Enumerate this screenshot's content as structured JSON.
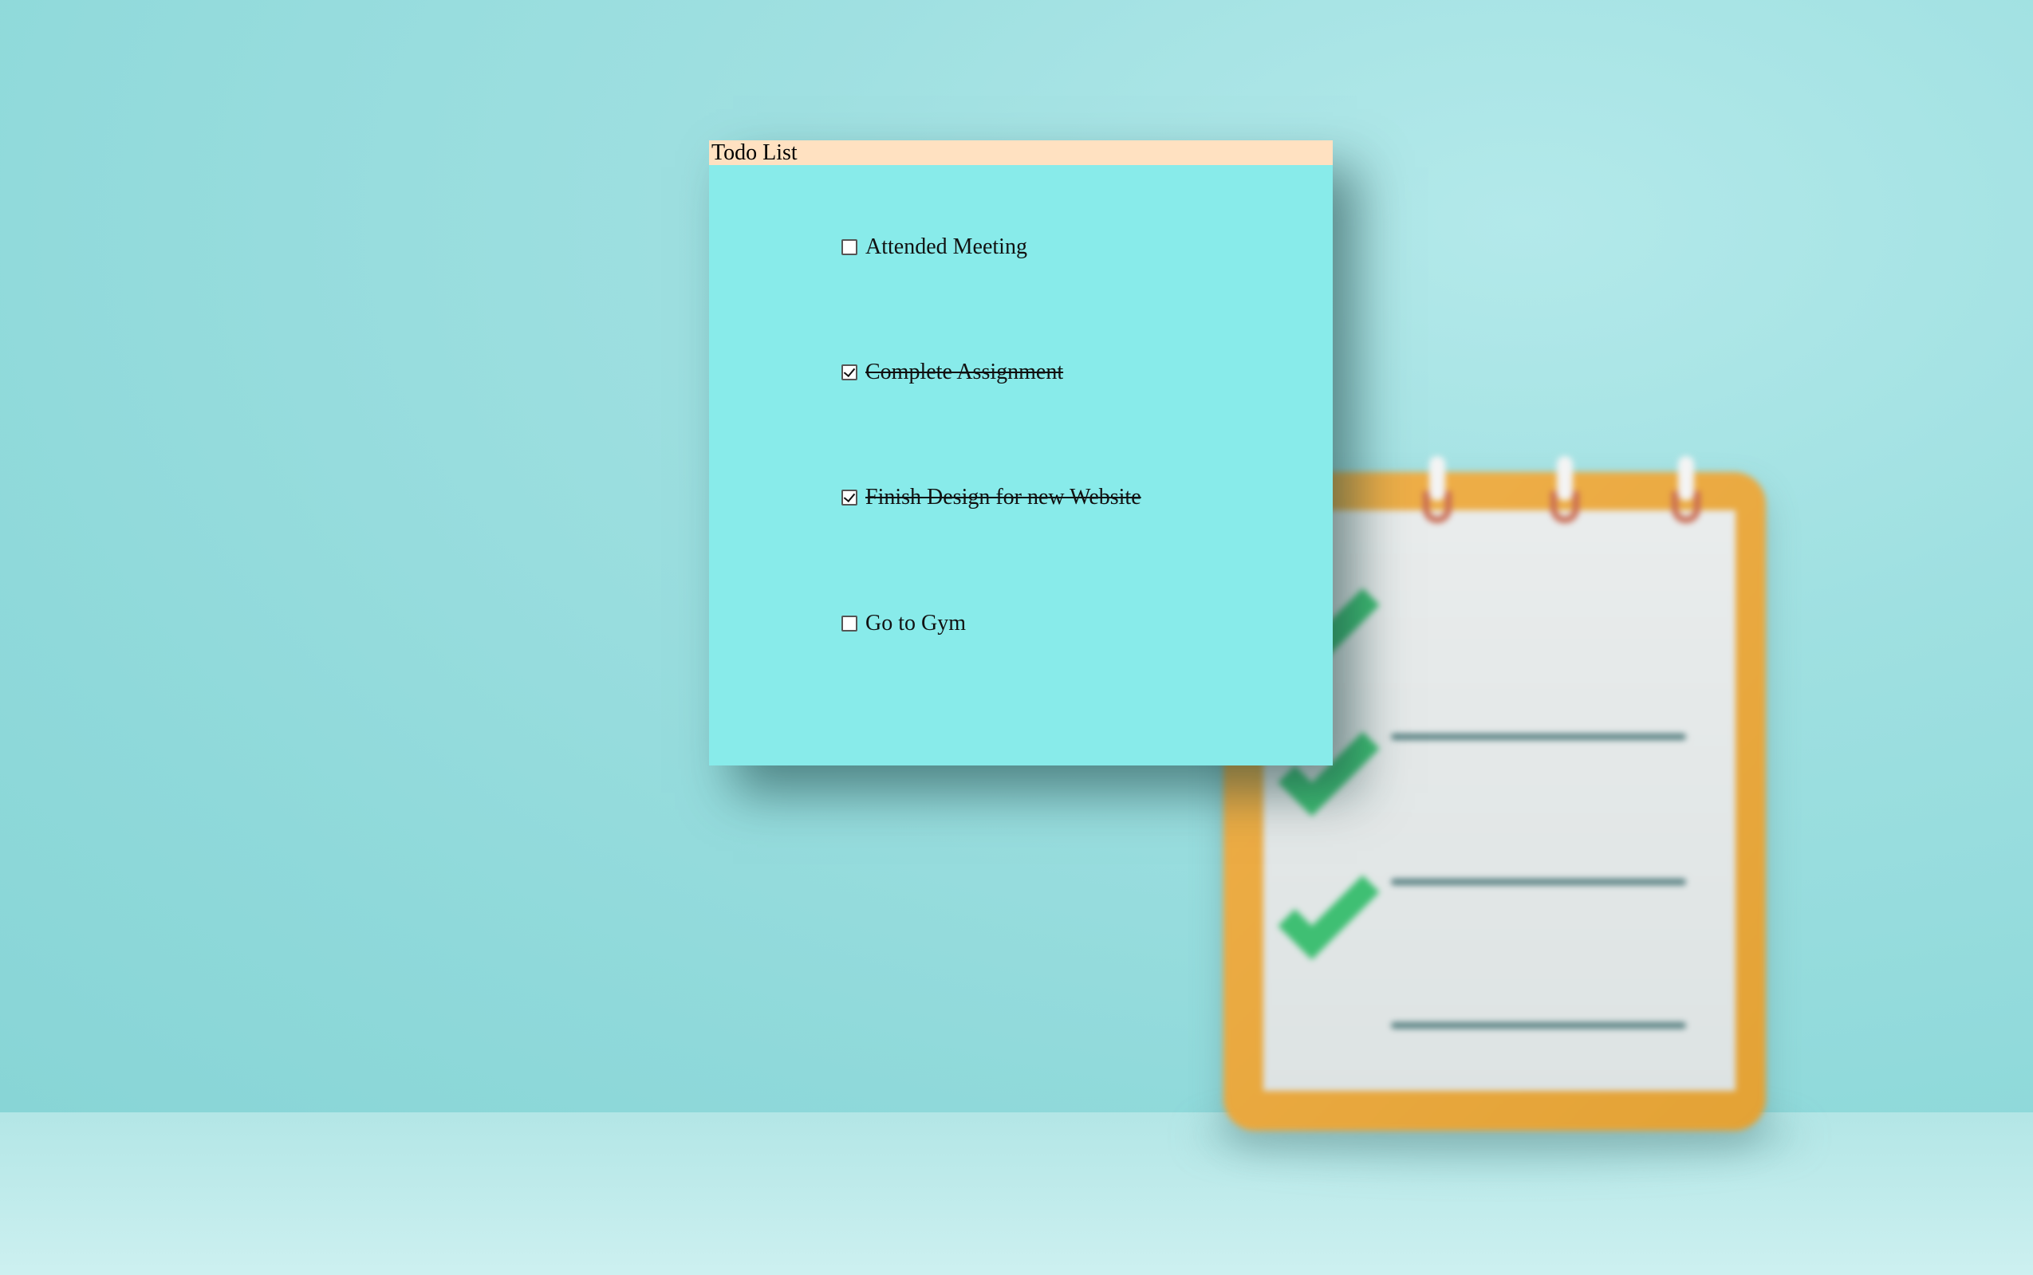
{
  "window": {
    "title": "Todo List"
  },
  "todos": [
    {
      "label": "Attended Meeting",
      "checked": false
    },
    {
      "label": "Complete Assignment",
      "checked": true
    },
    {
      "label": "Finish Design for new Website",
      "checked": true
    },
    {
      "label": "Go to Gym",
      "checked": false
    }
  ],
  "colors": {
    "titlebar": "#ffe1c1",
    "window_bg": "#88ebea",
    "background": "#93dcdd",
    "clipboard": "#e9a63c",
    "checkmark": "#3fbf73"
  },
  "icons": {
    "background_illustration": "clipboard-checklist-icon"
  }
}
